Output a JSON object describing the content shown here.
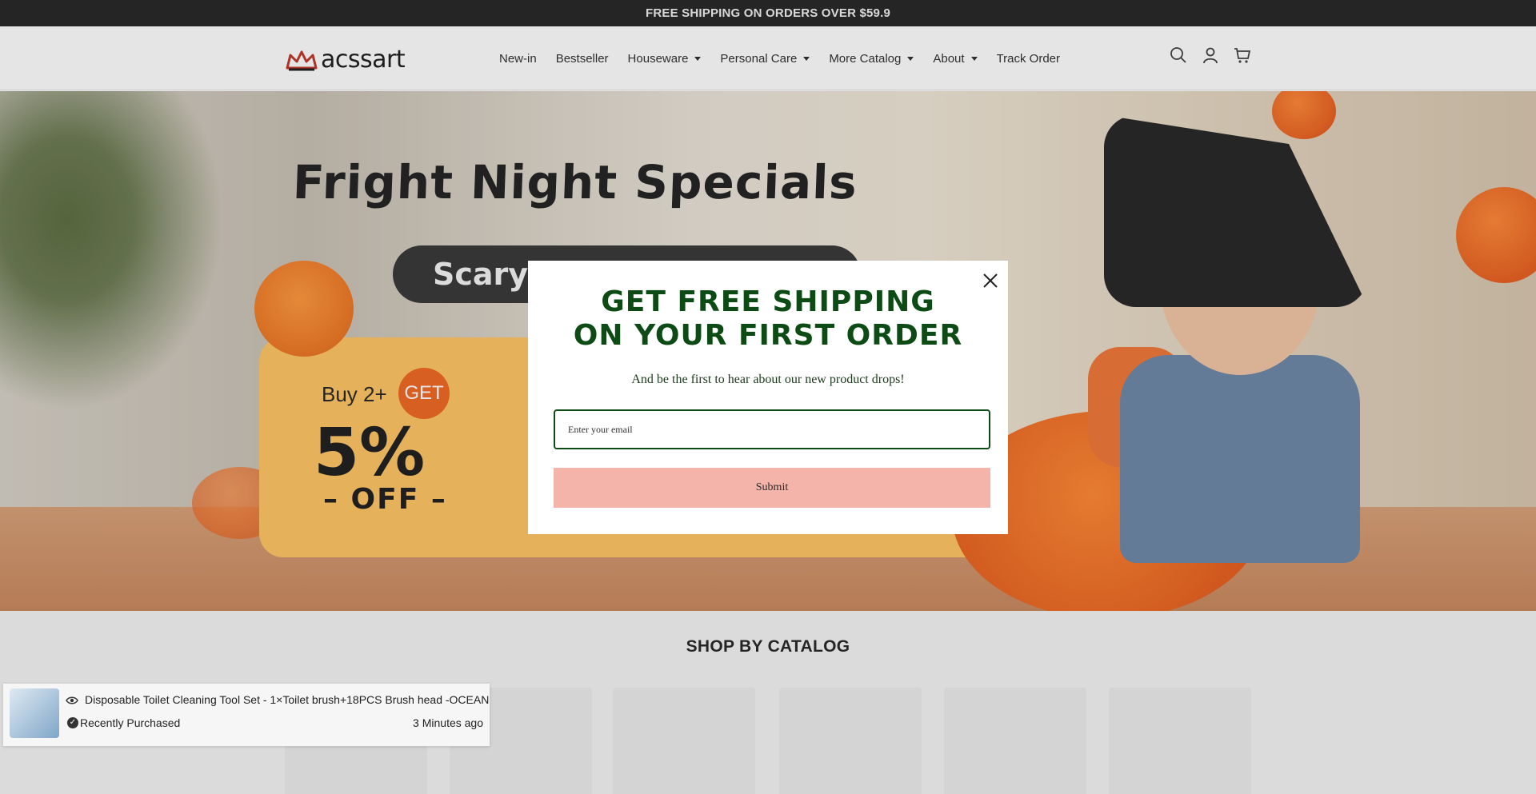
{
  "announcement": {
    "text": "FREE SHIPPING ON ORDERS OVER $59.9"
  },
  "header": {
    "logo_text": "acssart",
    "nav": [
      {
        "label": "New-in",
        "dropdown": false
      },
      {
        "label": "Bestseller",
        "dropdown": false
      },
      {
        "label": "Houseware",
        "dropdown": true
      },
      {
        "label": "Personal Care",
        "dropdown": true
      },
      {
        "label": "More Catalog",
        "dropdown": true
      },
      {
        "label": "About",
        "dropdown": true
      },
      {
        "label": "Track Order",
        "dropdown": false
      }
    ],
    "icons": [
      "search-icon",
      "account-icon",
      "cart-icon"
    ]
  },
  "hero": {
    "headline": "Fright Night Specials",
    "pill_text": "Scary-Good Deals",
    "buy_text": "Buy 2+",
    "get_text": "GET",
    "percent": "5%",
    "off_text": "– OFF –"
  },
  "catalog": {
    "title": "SHOP BY CATALOG"
  },
  "toast": {
    "product": "Disposable Toilet Cleaning Tool Set - 1×Toilet brush+18PCS Brush head -OCEAN",
    "label": "Recently Purchased",
    "time": "3 Minutes ago"
  },
  "modal": {
    "heading_line1": "GET FREE SHIPPING",
    "heading_line2": "ON YOUR FIRST ORDER",
    "subtext": "And be the first to hear about our new product drops!",
    "email_placeholder": "Enter your email",
    "submit_label": "Submit"
  },
  "colors": {
    "announcement_bg": "#2a2a2a",
    "modal_heading": "#0c4b14",
    "submit_bg": "#f5b4aa",
    "promo_card": "#ffc766"
  }
}
